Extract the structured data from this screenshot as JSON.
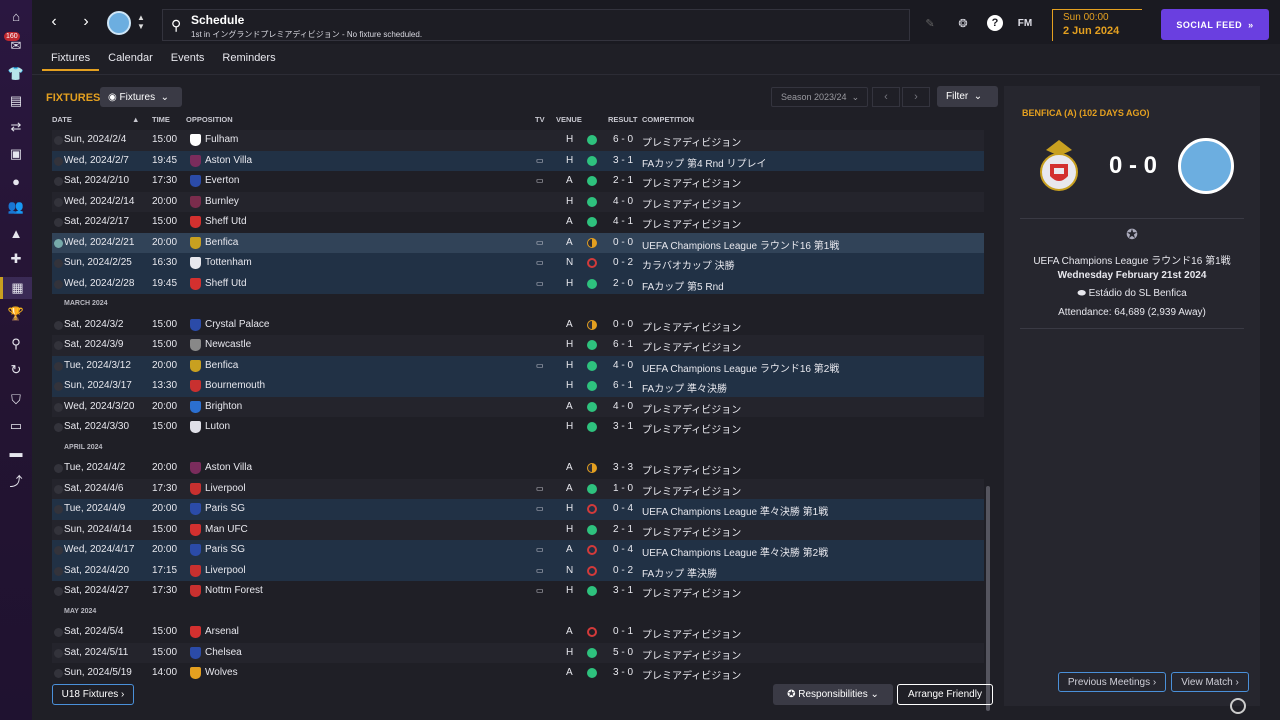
{
  "sidebar": {
    "badge": "160",
    "items": [
      "home-icon",
      "inbox-icon",
      "shirt-icon",
      "report-icon",
      "transfer-icon",
      "tactics-icon",
      "ball-icon",
      "squad-icon",
      "training-icon",
      "medical-icon",
      "schedule-icon",
      "trophy-icon",
      "scouting-icon",
      "refresh-icon",
      "club-icon",
      "finance-icon",
      "tickets-icon",
      "trend-icon"
    ]
  },
  "topbar": {
    "title": "Schedule",
    "subtitle": "1st in イングランドプレミアディビジョン - No fixture scheduled.",
    "fm": "FM",
    "day": "Sun 00:00",
    "date": "2 Jun 2024",
    "social": "SOCIAL FEED"
  },
  "tabs": [
    "Fixtures",
    "Calendar",
    "Events",
    "Reminders"
  ],
  "fixtures": {
    "title": "FIXTURES",
    "dropdown": "Fixtures",
    "season": "Season 2023/24",
    "filter": "Filter",
    "headers": {
      "date": "DATE",
      "time": "TIME",
      "opposition": "OPPOSITION",
      "tv": "TV",
      "venue": "VENUE",
      "result": "RESULT",
      "competition": "COMPETITION"
    },
    "rows": [
      {
        "date": "Sun, 2024/2/4",
        "time": "15:00",
        "opp": "Fulham",
        "tv": false,
        "venue": "H",
        "res": "w",
        "score": "6 - 0",
        "comp": "プレミアディビジョン",
        "style": "alt",
        "crest": "#ffffff"
      },
      {
        "date": "Wed, 2024/2/7",
        "time": "19:45",
        "opp": "Aston Villa",
        "tv": true,
        "venue": "H",
        "res": "w",
        "score": "3 - 1",
        "comp": "FAカップ 第4 Rnd リプレイ",
        "style": "cup",
        "crest": "#7a2c5c"
      },
      {
        "date": "Sat, 2024/2/10",
        "time": "17:30",
        "opp": "Everton",
        "tv": true,
        "venue": "A",
        "res": "w",
        "score": "2 - 1",
        "comp": "プレミアディビジョン",
        "style": "",
        "crest": "#2b4ba8"
      },
      {
        "date": "Wed, 2024/2/14",
        "time": "20:00",
        "opp": "Burnley",
        "tv": false,
        "venue": "H",
        "res": "w",
        "score": "4 - 0",
        "comp": "プレミアディビジョン",
        "style": "alt",
        "crest": "#7a2c4c"
      },
      {
        "date": "Sat, 2024/2/17",
        "time": "15:00",
        "opp": "Sheff Utd",
        "tv": false,
        "venue": "A",
        "res": "w",
        "score": "4 - 1",
        "comp": "プレミアディビジョン",
        "style": "",
        "crest": "#d3302f"
      },
      {
        "date": "Wed, 2024/2/21",
        "time": "20:00",
        "opp": "Benfica",
        "tv": true,
        "venue": "A",
        "res": "d",
        "score": "0 - 0",
        "comp": "UEFA Champions League ラウンド16 第1戦",
        "style": "sel",
        "crest": "#c8a020"
      },
      {
        "date": "Sun, 2024/2/25",
        "time": "16:30",
        "opp": "Tottenham",
        "tv": true,
        "venue": "N",
        "res": "l",
        "score": "0 - 2",
        "comp": "カラバオカップ 決勝",
        "style": "cup",
        "crest": "#e8e8ee"
      },
      {
        "date": "Wed, 2024/2/28",
        "time": "19:45",
        "opp": "Sheff Utd",
        "tv": true,
        "venue": "H",
        "res": "w",
        "score": "2 - 0",
        "comp": "FAカップ 第5 Rnd",
        "style": "cup",
        "crest": "#d3302f"
      },
      {
        "month": "MARCH 2024"
      },
      {
        "date": "Sat, 2024/3/2",
        "time": "15:00",
        "opp": "Crystal Palace",
        "tv": false,
        "venue": "A",
        "res": "d",
        "score": "0 - 0",
        "comp": "プレミアディビジョン",
        "style": "",
        "crest": "#2b4ba8"
      },
      {
        "date": "Sat, 2024/3/9",
        "time": "15:00",
        "opp": "Newcastle",
        "tv": false,
        "venue": "H",
        "res": "w",
        "score": "6 - 1",
        "comp": "プレミアディビジョン",
        "style": "alt",
        "crest": "#888888"
      },
      {
        "date": "Tue, 2024/3/12",
        "time": "20:00",
        "opp": "Benfica",
        "tv": true,
        "venue": "H",
        "res": "w",
        "score": "4 - 0",
        "comp": "UEFA Champions League ラウンド16 第2戦",
        "style": "cup",
        "crest": "#c8a020"
      },
      {
        "date": "Sun, 2024/3/17",
        "time": "13:30",
        "opp": "Bournemouth",
        "tv": false,
        "venue": "H",
        "res": "w",
        "score": "6 - 1",
        "comp": "FAカップ 準々決勝",
        "style": "cup",
        "crest": "#c8302f"
      },
      {
        "date": "Wed, 2024/3/20",
        "time": "20:00",
        "opp": "Brighton",
        "tv": false,
        "venue": "A",
        "res": "w",
        "score": "4 - 0",
        "comp": "プレミアディビジョン",
        "style": "alt",
        "crest": "#2b6fd0"
      },
      {
        "date": "Sat, 2024/3/30",
        "time": "15:00",
        "opp": "Luton",
        "tv": false,
        "venue": "H",
        "res": "w",
        "score": "3 - 1",
        "comp": "プレミアディビジョン",
        "style": "",
        "crest": "#e0e0e8"
      },
      {
        "month": "APRIL 2024"
      },
      {
        "date": "Tue, 2024/4/2",
        "time": "20:00",
        "opp": "Aston Villa",
        "tv": false,
        "venue": "A",
        "res": "d",
        "score": "3 - 3",
        "comp": "プレミアディビジョン",
        "style": "",
        "crest": "#7a2c5c"
      },
      {
        "date": "Sat, 2024/4/6",
        "time": "17:30",
        "opp": "Liverpool",
        "tv": true,
        "venue": "A",
        "res": "w",
        "score": "1 - 0",
        "comp": "プレミアディビジョン",
        "style": "alt",
        "crest": "#c8302f"
      },
      {
        "date": "Tue, 2024/4/9",
        "time": "20:00",
        "opp": "Paris SG",
        "tv": true,
        "venue": "H",
        "res": "l",
        "score": "0 - 4",
        "comp": "UEFA Champions League 準々決勝 第1戦",
        "style": "cup",
        "crest": "#2b4ba8"
      },
      {
        "date": "Sun, 2024/4/14",
        "time": "15:00",
        "opp": "Man UFC",
        "tv": false,
        "venue": "H",
        "res": "w",
        "score": "2 - 1",
        "comp": "プレミアディビジョン",
        "style": "alt",
        "crest": "#d3302f"
      },
      {
        "date": "Wed, 2024/4/17",
        "time": "20:00",
        "opp": "Paris SG",
        "tv": true,
        "venue": "A",
        "res": "l",
        "score": "0 - 4",
        "comp": "UEFA Champions League 準々決勝 第2戦",
        "style": "cup",
        "crest": "#2b4ba8"
      },
      {
        "date": "Sat, 2024/4/20",
        "time": "17:15",
        "opp": "Liverpool",
        "tv": true,
        "venue": "N",
        "res": "l",
        "score": "0 - 2",
        "comp": "FAカップ 準決勝",
        "style": "cup",
        "crest": "#c8302f"
      },
      {
        "date": "Sat, 2024/4/27",
        "time": "17:30",
        "opp": "Nottm Forest",
        "tv": true,
        "venue": "H",
        "res": "w",
        "score": "3 - 1",
        "comp": "プレミアディビジョン",
        "style": "",
        "crest": "#c8302f"
      },
      {
        "month": "MAY 2024"
      },
      {
        "date": "Sat, 2024/5/4",
        "time": "15:00",
        "opp": "Arsenal",
        "tv": false,
        "venue": "A",
        "res": "l",
        "score": "0 - 1",
        "comp": "プレミアディビジョン",
        "style": "",
        "crest": "#d3302f"
      },
      {
        "date": "Sat, 2024/5/11",
        "time": "15:00",
        "opp": "Chelsea",
        "tv": false,
        "venue": "H",
        "res": "w",
        "score": "5 - 0",
        "comp": "プレミアディビジョン",
        "style": "alt",
        "crest": "#2b4ba8"
      },
      {
        "date": "Sun, 2024/5/19",
        "time": "14:00",
        "opp": "Wolves",
        "tv": false,
        "venue": "A",
        "res": "w",
        "score": "3 - 0",
        "comp": "プレミアディビジョン",
        "style": "",
        "crest": "#e4a020"
      }
    ],
    "u18": "U18 Fixtures",
    "responsibilities": "Responsibilities",
    "arrange": "Arrange Friendly"
  },
  "panel": {
    "title": "BENFICA (A) (102 DAYS AGO)",
    "score": "0 - 0",
    "competition": "UEFA Champions League ラウンド16 第1戦",
    "date": "Wednesday February 21st 2024",
    "stadium": "Estádio do SL Benfica",
    "attendance": "Attendance: 64,689 (2,939 Away)",
    "prev": "Previous Meetings",
    "view": "View Match"
  }
}
